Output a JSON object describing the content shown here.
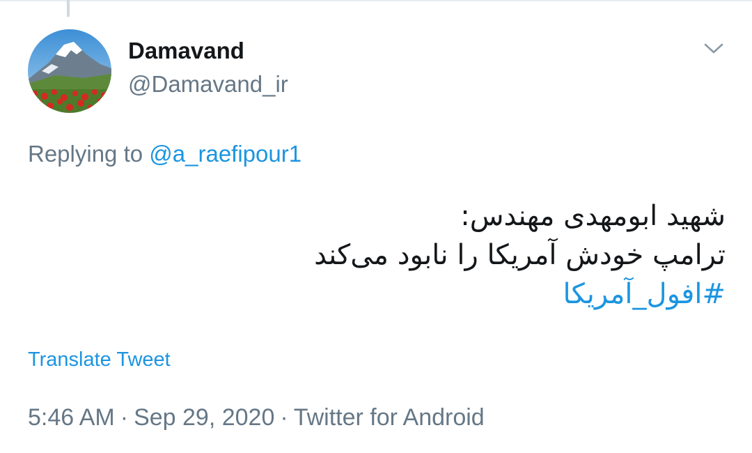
{
  "tweet": {
    "author": {
      "display_name": "Damavand",
      "handle": "@Damavand_ir"
    },
    "replying_to": {
      "prefix": "Replying to",
      "handle": "@a_raefipour1"
    },
    "text_lines": [
      "شهید ابومهدی مهندس:",
      "ترامپ خودش آمریکا را نابود می‌کند"
    ],
    "hashtag": "#افول_آمریکا",
    "translate_label": "Translate Tweet",
    "time": "5:46 AM",
    "date": "Sep 29, 2020",
    "source": "Twitter for Android",
    "separator": "·"
  },
  "icons": {
    "caret": "chevron-down-icon",
    "avatar": "avatar-mountain-image"
  },
  "colors": {
    "link": "#1b95e0",
    "secondary_text": "#657786",
    "primary_text": "#14171a"
  }
}
